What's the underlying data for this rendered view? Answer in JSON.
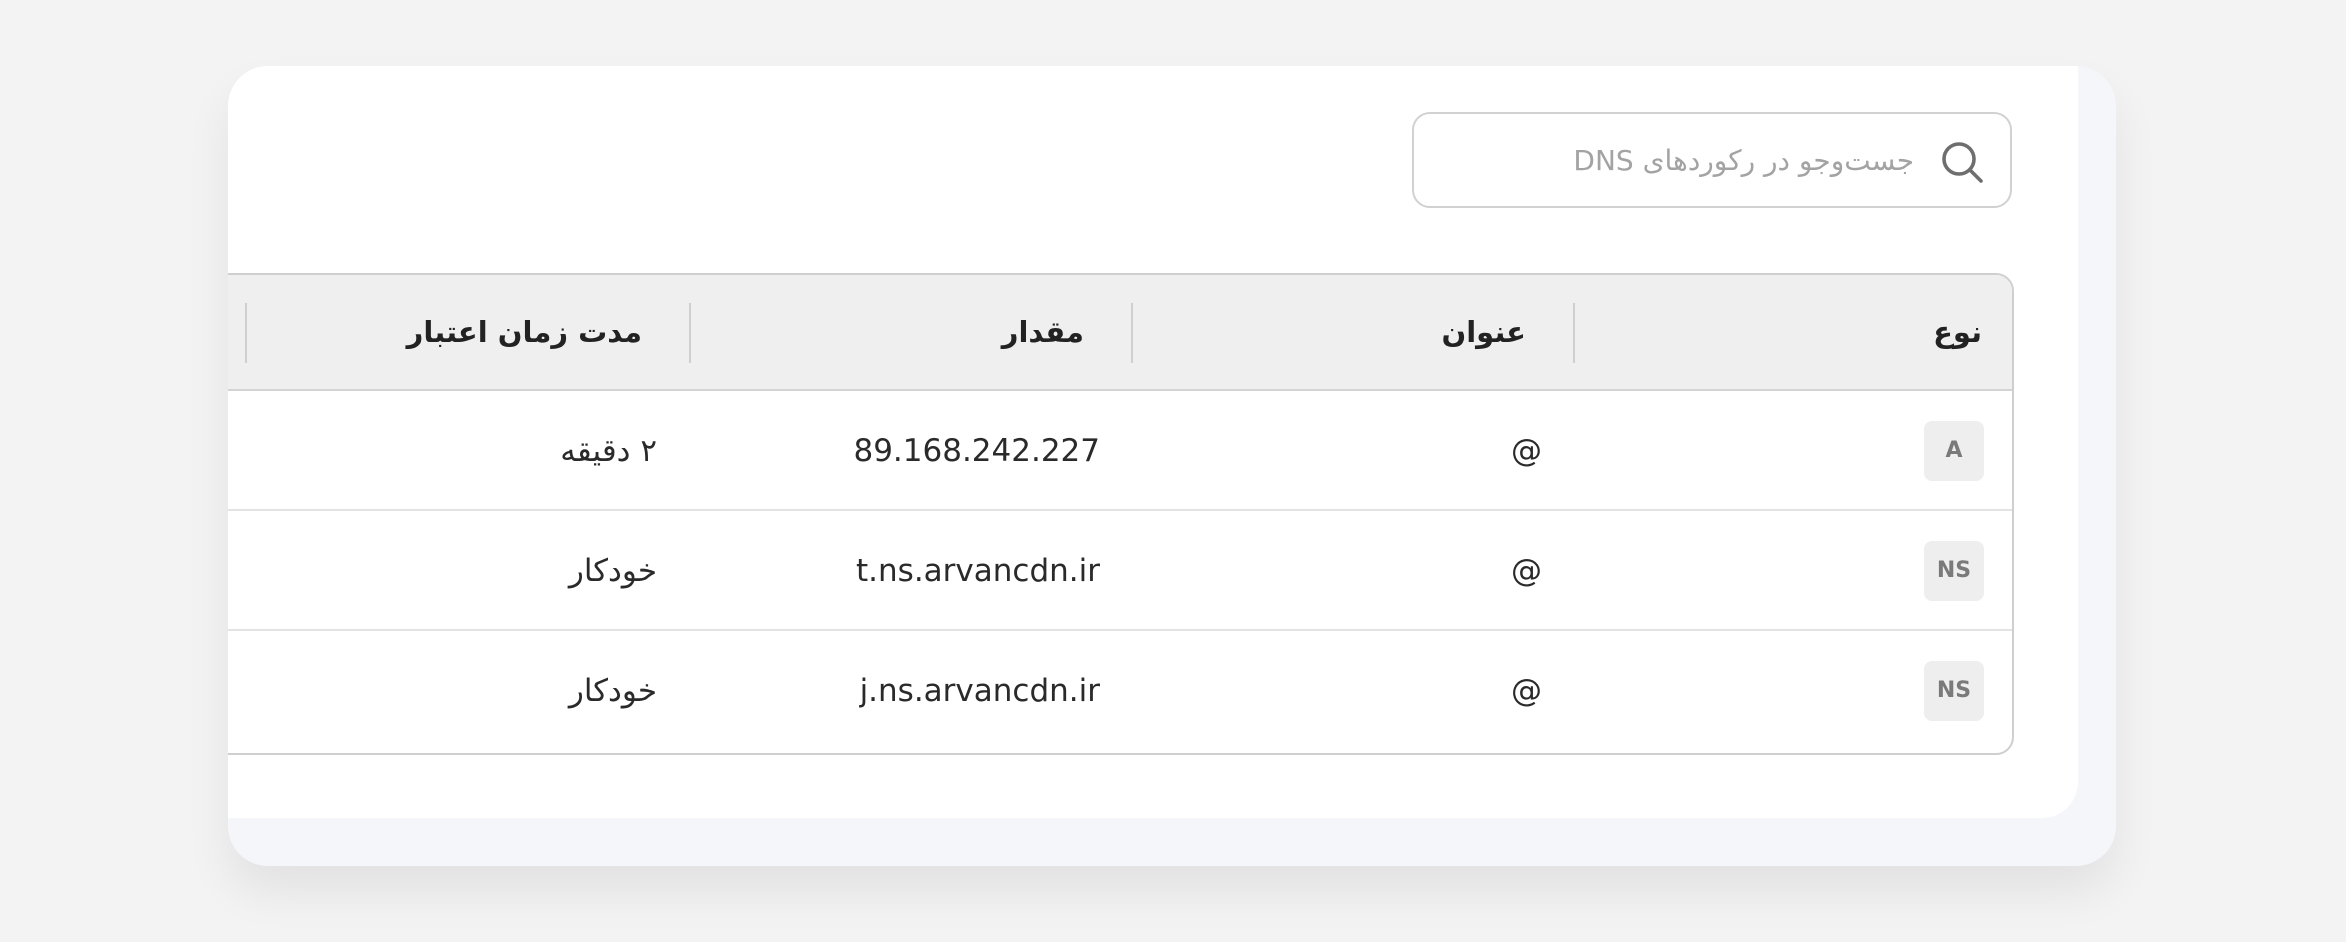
{
  "search": {
    "placeholder": "جست‌وجو در رکوردهای DNS",
    "value": ""
  },
  "table": {
    "columns": {
      "type": "نوع",
      "name": "عنوان",
      "value": "مقدار",
      "ttl": "مدت زمان اعتبار"
    },
    "rows": [
      {
        "type": "A",
        "name": "@",
        "value": "89.168.242.227",
        "ttl": "۲ دقیقه"
      },
      {
        "type": "NS",
        "name": "@",
        "value": "t.ns.arvancdn.ir",
        "ttl": "خودکار"
      },
      {
        "type": "NS",
        "name": "@",
        "value": "j.ns.arvancdn.ir",
        "ttl": "خودکار"
      }
    ]
  },
  "colors": {
    "background": "#f3f3f4",
    "card": "#ffffff",
    "header_bg": "#efefef",
    "border": "#cfcfcf",
    "badge_bg": "#eeeeee",
    "badge_text": "#7a7a7a"
  },
  "icons": {
    "search": "search-icon"
  }
}
